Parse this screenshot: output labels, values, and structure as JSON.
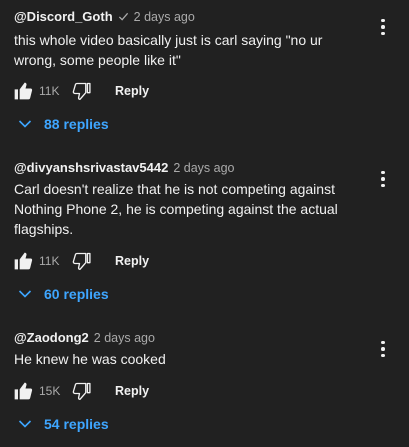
{
  "comments": [
    {
      "author": "@Discord_Goth",
      "verified": true,
      "timestamp": "2 days ago",
      "text": "this whole video basically just is carl saying \"no ur wrong, some people like it\"",
      "likes": "11K",
      "reply_label": "Reply",
      "replies_label": "88 replies"
    },
    {
      "author": "@divyanshsrivastav5442",
      "verified": false,
      "timestamp": "2 days ago",
      "text": "Carl doesn't realize that he is not competing against Nothing Phone 2, he is competing against the actual flagships.",
      "likes": "11K",
      "reply_label": "Reply",
      "replies_label": "60 replies"
    },
    {
      "author": "@Zaodong2",
      "verified": false,
      "timestamp": "2 days ago",
      "text": "He knew he was cooked",
      "likes": "15K",
      "reply_label": "Reply",
      "replies_label": "54 replies"
    }
  ],
  "icons": {
    "like": "thumb-up-icon",
    "dislike": "thumb-down-icon",
    "menu": "more-vert-icon",
    "verified": "check-icon",
    "expand": "chevron-down-icon"
  },
  "colors": {
    "background": "#212121",
    "text": "#f1f1f1",
    "secondary": "#aaaaaa",
    "link": "#3ea6ff"
  }
}
